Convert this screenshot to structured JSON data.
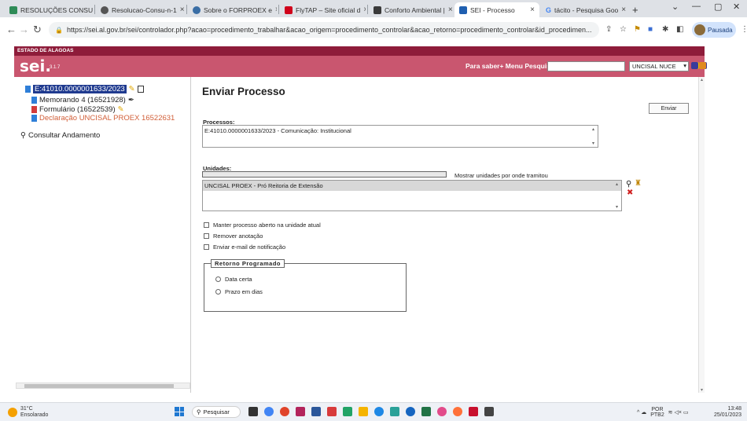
{
  "browser": {
    "tabs": [
      {
        "label": "RESOLUÇÕES CONSU",
        "fav": "#2e8b57"
      },
      {
        "label": "Resolucao-Consu-n-1",
        "fav": "#555555"
      },
      {
        "label": "Sobre o FORPROEX e",
        "fav": "#3a6ea5"
      },
      {
        "label": "FlyTAP – Site oficial d",
        "fav": "#d0021b"
      },
      {
        "label": "Conforto Ambiental |",
        "fav": "#3a3a3a"
      },
      {
        "label": "SEI - Processo",
        "fav": "#1f5fb0"
      },
      {
        "label": "tácito - Pesquisa Goo",
        "fav": "#4285f4"
      }
    ],
    "new_tab": "+",
    "url": "https://sei.al.gov.br/sei/controlador.php?acao=procedimento_trabalhar&acao_origem=procedimento_controlar&acao_retorno=procedimento_controlar&id_procedimen...",
    "profile_status": "Pausada"
  },
  "sei": {
    "estado": "ESTADO DE ALAGOAS",
    "logo": "sei.",
    "version": "3.1.7",
    "links": "Para saber+  Menu  Pesquisa",
    "unit": "UNCISAL NUCE"
  },
  "tree": {
    "process": "E:41010.0000001633/2023",
    "docs": [
      "Memorando 4 (16521928)",
      "Formulário (16522539)",
      "Declaração UNCISAL PROEX 16522631"
    ],
    "consultar": "Consultar Andamento"
  },
  "form": {
    "title": "Enviar Processo",
    "enviar": "Enviar",
    "processos_label": "Processos:",
    "processos_value": "E:41010.0000001633/2023 - Comunicação: Institucional",
    "unidades_label": "Unidades:",
    "mostrar": "Mostrar unidades por onde tramitou",
    "unidade_selected": "UNCISAL PROEX - Pró Reitoria de Extensão",
    "checkboxes": [
      "Manter processo aberto na unidade atual",
      "Remover anotação",
      "Enviar e-mail de notificação"
    ],
    "retorno_legend": "Retorno Programado",
    "radios": [
      "Data certa",
      "Prazo em dias"
    ]
  },
  "taskbar": {
    "temp": "31°C",
    "weather": "Ensolarado",
    "search": "Pesquisar",
    "lang1": "POR",
    "lang2": "PTB2",
    "time": "13:48",
    "date": "25/01/2023"
  }
}
